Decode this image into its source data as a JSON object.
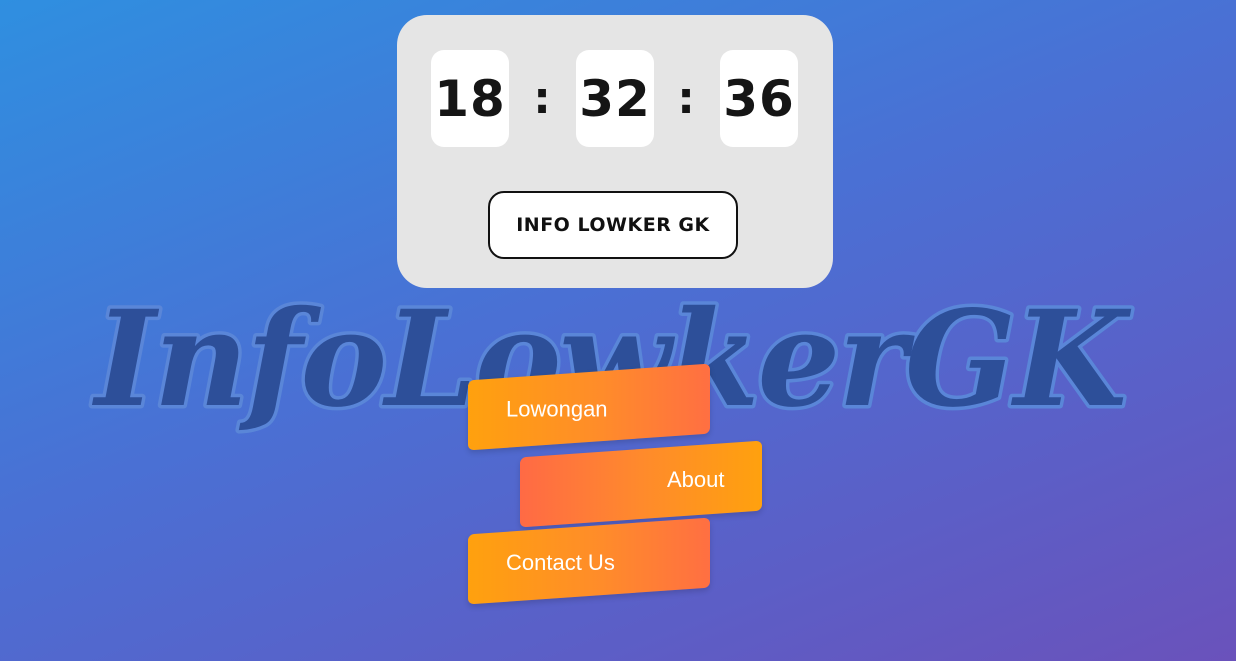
{
  "clock": {
    "hours": "18",
    "minutes": "32",
    "seconds": "36",
    "separator": ":"
  },
  "info_button": {
    "label": "INFO LOWKER GK"
  },
  "logo": {
    "text": "InfoLowkerGK",
    "fill_color": "#2d4f99",
    "outline_color": "#5a86d8"
  },
  "menu": {
    "items": [
      {
        "label": "Lowongan"
      },
      {
        "label": "About"
      },
      {
        "label": "Contact Us"
      }
    ],
    "gradient_start": "#ffa10e",
    "gradient_end": "#ff6a45"
  },
  "colors": {
    "background_top": "#2f8fe0",
    "background_bottom": "#6a52bb",
    "card": "#e5e5e5"
  }
}
